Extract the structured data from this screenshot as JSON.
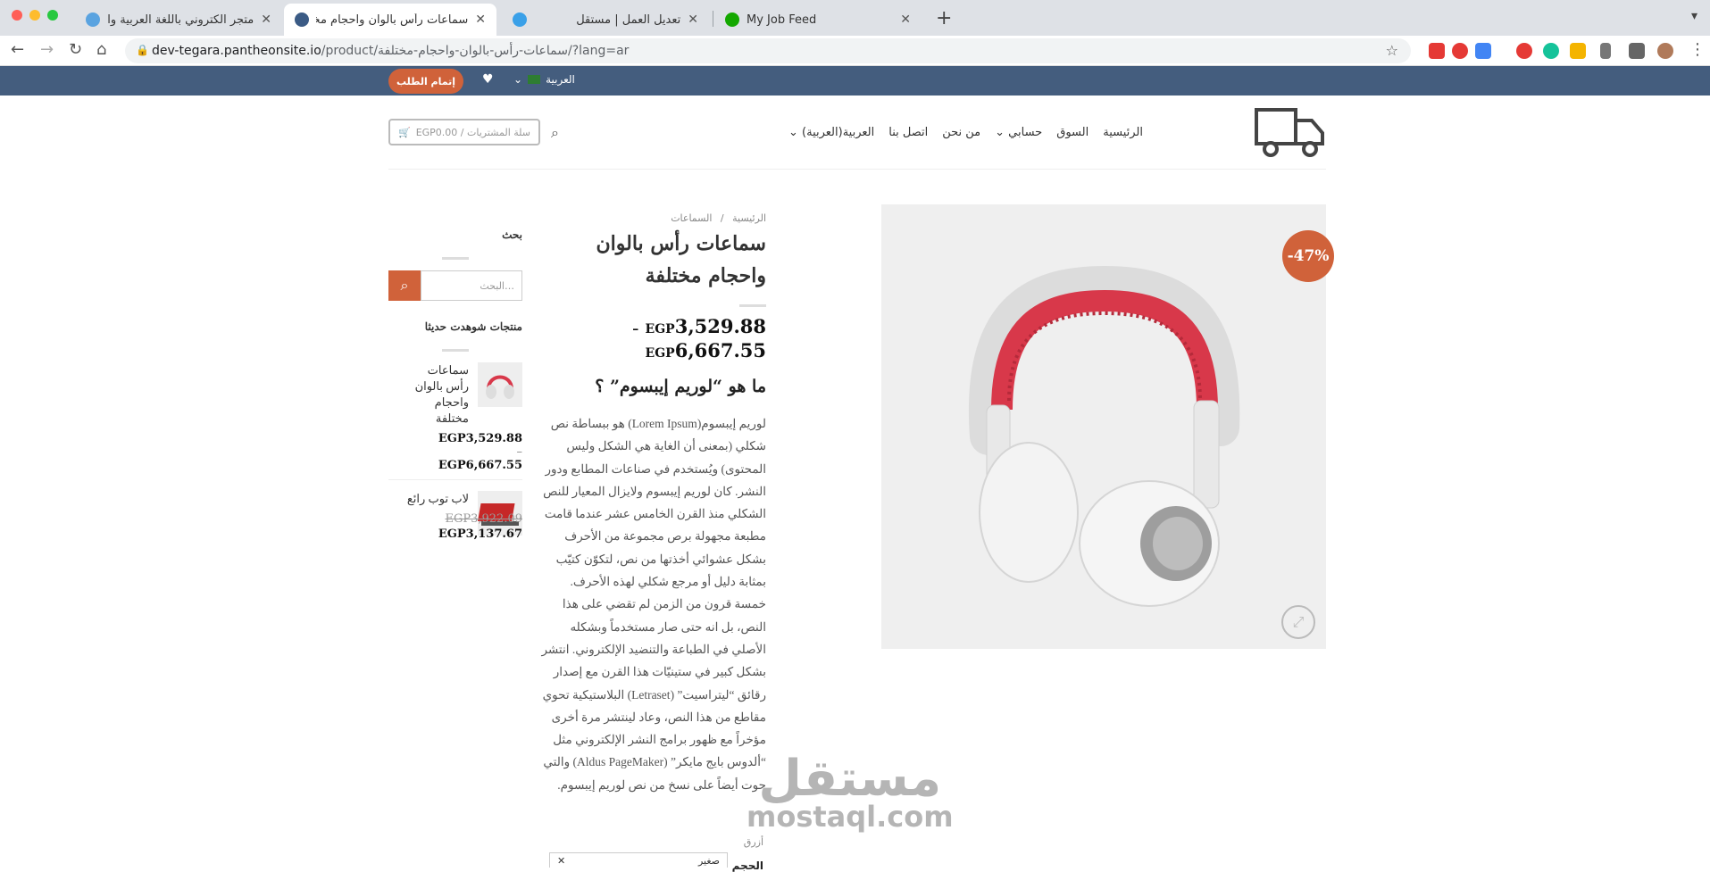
{
  "browser": {
    "tabs": [
      {
        "title": "متجر الكتروني باللغة العربية والانجلي",
        "active": false
      },
      {
        "title": "سماعات رأس بالوان واحجام مختلفة",
        "active": true
      },
      {
        "title": "تعديل العمل | مستقل",
        "active": false
      },
      {
        "title": "My Job Feed",
        "active": false
      }
    ],
    "url_host": "dev-tegara.pantheonsite.io",
    "url_path": "/product/سماعات-رأس-بالوان-واحجام-مختلفة/?lang=ar"
  },
  "topbar": {
    "checkout_label": "إتمام الطلب",
    "language_label": "العربية"
  },
  "header": {
    "menu": [
      "الرئيسية",
      "السوق",
      "حسابي",
      "من نحن",
      "اتصل بنا",
      "العربية(العربية)"
    ],
    "cart_label": "سلة المشتريات / EGP0.00"
  },
  "product": {
    "breadcrumb_home": "الرئيسية",
    "breadcrumb_sep": "/",
    "breadcrumb_cat": "السماعات",
    "title": "سماعات رأس بالوان واحجام مختلفة",
    "price_low": "3,529.88",
    "price_high": "6,667.55",
    "currency": "EGP",
    "price_dash": "–",
    "discount_badge": "-47%",
    "subheading": "ما هو “لوريم إيبسوم” ؟",
    "description": "لوريم إيبسوم(Lorem Ipsum) هو ببساطة نص شكلي (بمعنى أن الغاية هي الشكل وليس المحتوى) ويُستخدم في صناعات المطابع ودور النشر. كان لوريم إيبسوم ولايزال المعيار للنص الشكلي منذ القرن الخامس عشر عندما قامت مطبعة مجهولة برص مجموعة من الأحرف بشكل عشوائي أخذتها من نص، لتكوّن كتيّب بمثابة دليل أو مرجع شكلي لهذه الأحرف. خمسة قرون من الزمن لم تقضي على هذا النص، بل انه حتى صار مستخدماً وبشكله الأصلي في الطباعة والتنضيد الإلكتروني. انتشر بشكل كبير في ستينيّات هذا القرن مع إصدار رقائق “ليتراسيت” (Letraset) البلاستيكية تحوي مقاطع من هذا النص، وعاد لينتشر مرة أخرى مؤخراً مع ظهور برامج النشر الإلكتروني مثل “ألدوس بايج مايكر” (Aldus PageMaker) والتي حوت أيضاً على نسخ من نص لوريم إيبسوم.",
    "size_label": "الحجم",
    "size_value": "صغير",
    "size_hint": "أزرق"
  },
  "sidebar": {
    "search_heading": "بحث",
    "search_placeholder": "البحث…",
    "recent_heading": "منتجات شوهدت حديثا",
    "recent": [
      {
        "name": "سماعات رأس بالوان واحجام مختلفة",
        "price_a": "EGP3,529.88",
        "dash": "–",
        "price_b": "EGP6,667.55"
      },
      {
        "name": "لاب توب رائع",
        "price_old": "EGP3,922.09",
        "price_new": "EGP3,137.67"
      }
    ]
  },
  "watermark": {
    "arabic": "مستقل",
    "latin": "mostaql.com"
  },
  "colors": {
    "accent": "#d0623a",
    "topbar": "#445d7e"
  }
}
